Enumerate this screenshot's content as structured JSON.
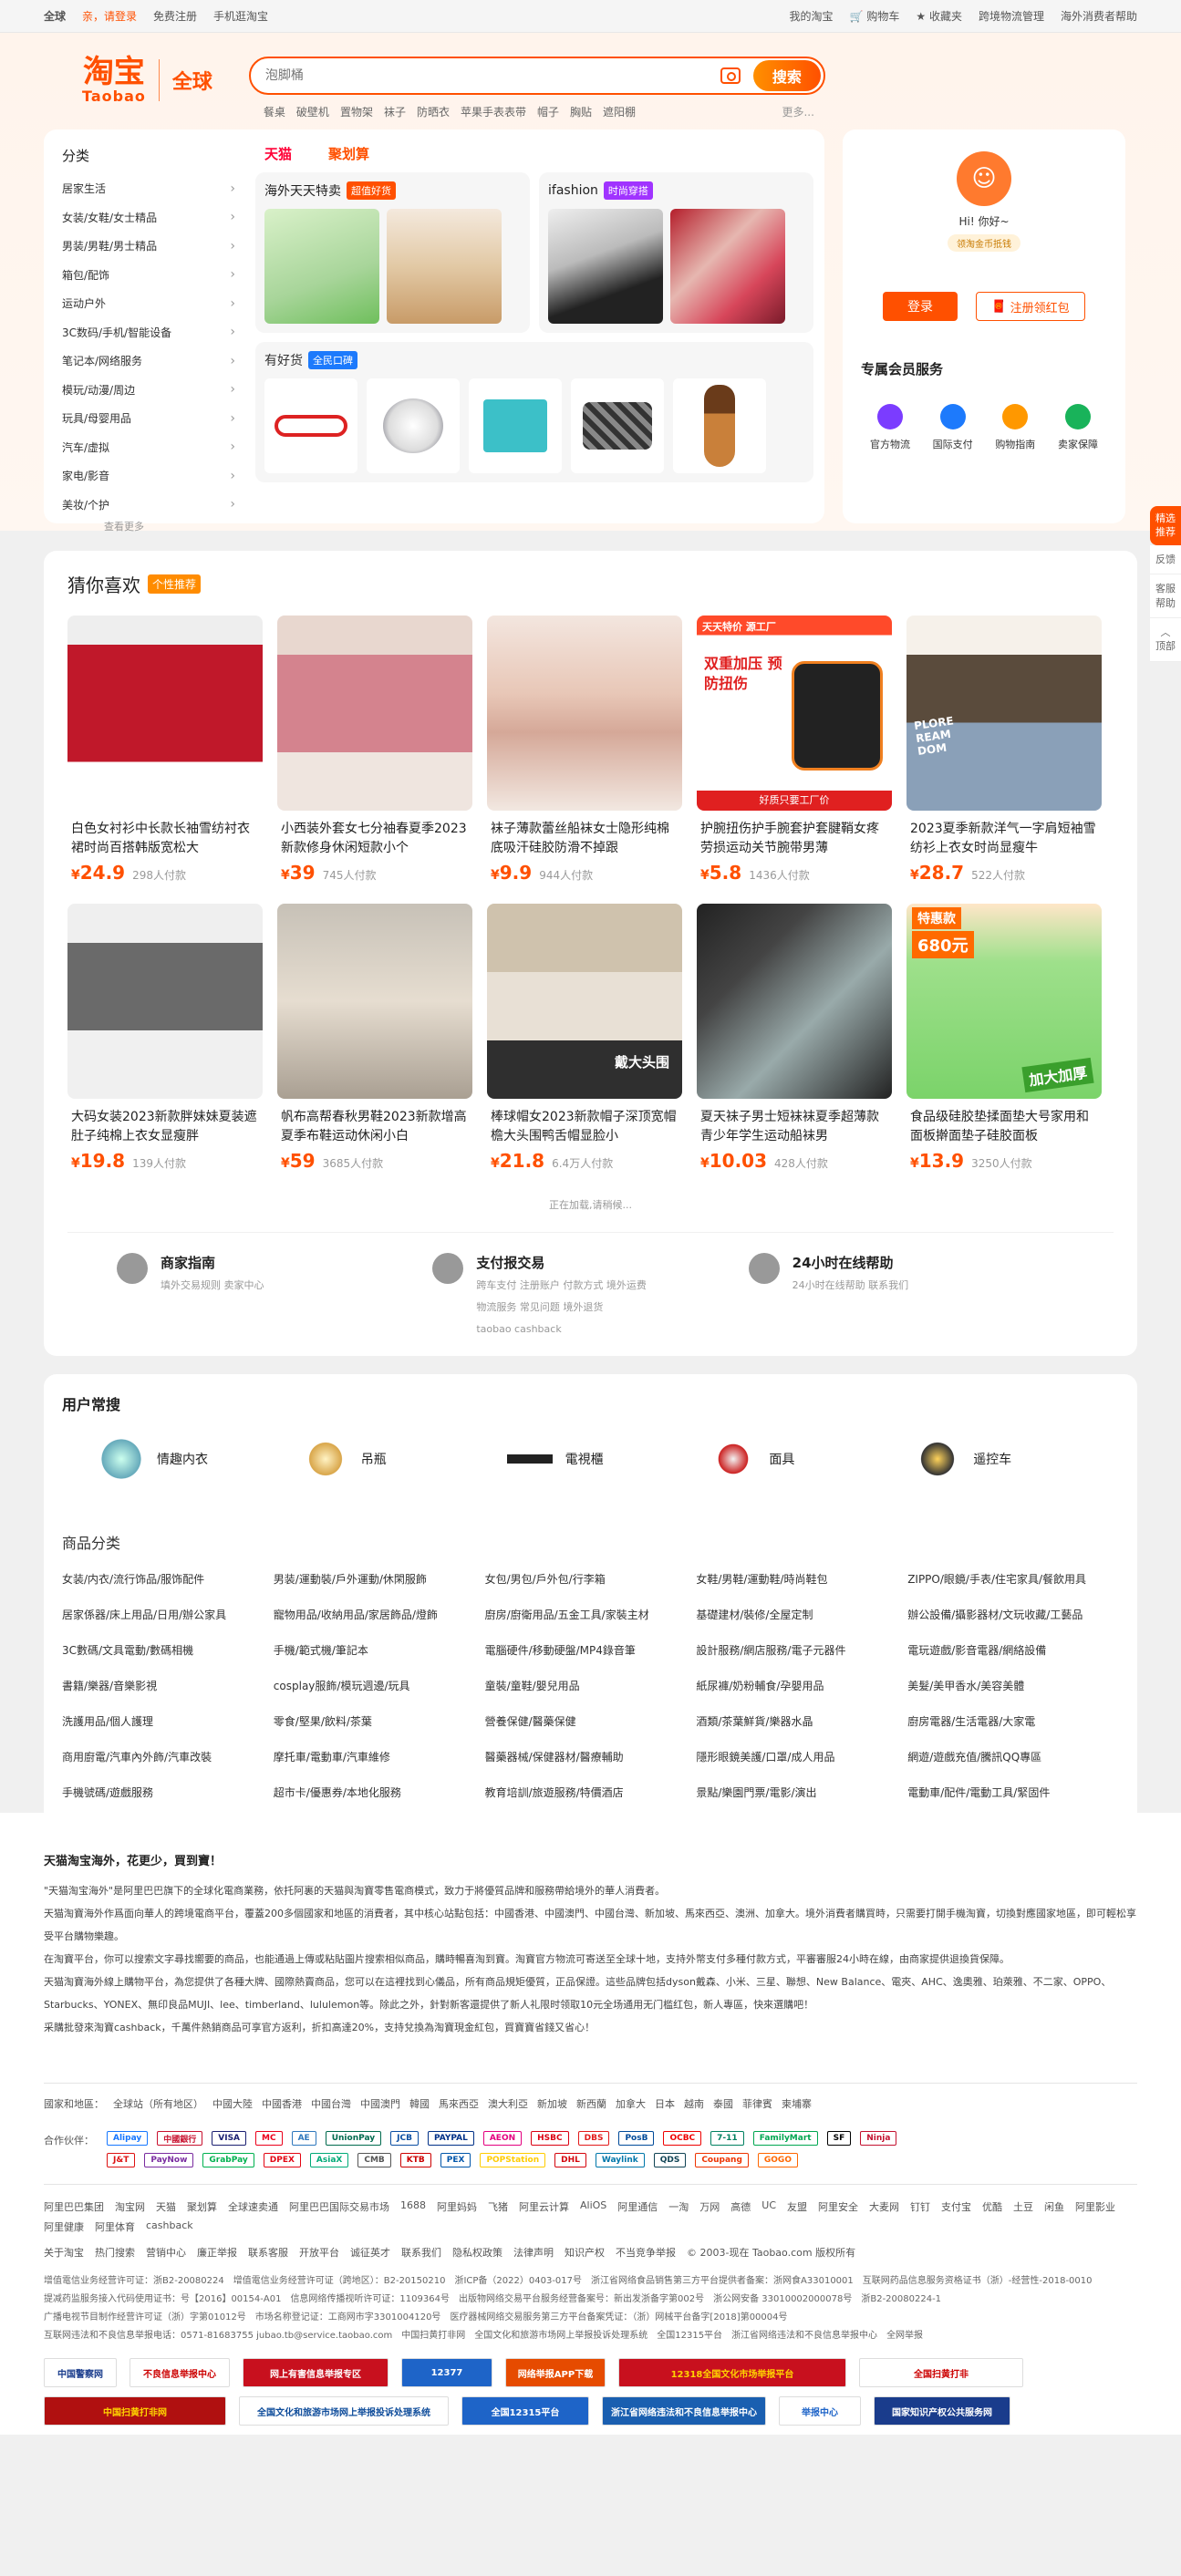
{
  "topbar": {
    "region": "全球",
    "greeting": "亲，请登录",
    "register": "免费注册",
    "mobile": "手机逛淘宝",
    "my_taobao": "我的淘宝",
    "cart": "购物车",
    "favorites": "收藏夹",
    "logistics": "跨境物流管理",
    "help": "海外消费者帮助"
  },
  "logo": {
    "cn": "淘宝",
    "en": "Taobao",
    "global": "全球"
  },
  "search": {
    "placeholder": "泡脚桶",
    "button": "搜索",
    "hotwords": [
      "餐桌",
      "破壁机",
      "置物架",
      "袜子",
      "防晒衣",
      "苹果手表表带",
      "帽子",
      "胸贴",
      "遮阳棚"
    ],
    "more": "更多..."
  },
  "categories": {
    "title": "分类",
    "items": [
      "居家生活",
      "女装/女鞋/女士精品",
      "男装/男鞋/男士精品",
      "箱包/配饰",
      "运动户外",
      "3C数码/手机/智能设备",
      "笔记本/网络服务",
      "模玩/动漫/周边",
      "玩具/母婴用品",
      "汽车/虚拟",
      "家电/影音",
      "美妆/个护"
    ],
    "more": "查看更多"
  },
  "promo": {
    "tab_tmall": "天猫",
    "tab_jhs": "聚划算",
    "haiwai": {
      "title": "海外天天特卖",
      "badge": "超值好货"
    },
    "ifashion": {
      "title": "ifashion",
      "badge": "时尚穿搭"
    },
    "youhaohuo": {
      "title": "有好货",
      "badge": "全民口碑"
    }
  },
  "user": {
    "hi": "Hi! 你好~",
    "level": "领淘金币抵钱",
    "login": "登录",
    "register": "注册领红包",
    "services_title": "专属会员服务",
    "services": [
      "官方物流",
      "国际支付",
      "购物指南",
      "卖家保障"
    ]
  },
  "float": {
    "recommend": "精选推荐",
    "feedback": "反馈",
    "service": "客服帮助",
    "top": "顶部"
  },
  "guess": {
    "title": "猜你喜欢",
    "badge": "个性推荐",
    "items": [
      {
        "title": "白色女衬衫中长款长袖雪纺衬衣裙时尚百搭韩版宽松大",
        "price": "24.9",
        "sold": "298人付款"
      },
      {
        "title": "小西装外套女七分袖春夏季2023新款修身休闲短款小个",
        "price": "39",
        "sold": "745人付款"
      },
      {
        "title": "袜子薄款蕾丝船袜女士隐形纯棉底吸汗硅胶防滑不掉跟",
        "price": "9.9",
        "sold": "944人付款"
      },
      {
        "title": "护腕扭伤护手腕套护套腱鞘女疼劳损运动关节腕带男薄",
        "price": "5.8",
        "sold": "1436人付款"
      },
      {
        "title": "2023夏季新款洋气一字肩短袖雪纺衫上衣女时尚显瘦牛",
        "price": "28.7",
        "sold": "522人付款"
      },
      {
        "title": "大码女装2023新款胖妹妹夏装遮肚子纯棉上衣女显瘦胖",
        "price": "19.8",
        "sold": "139人付款"
      },
      {
        "title": "帆布高帮春秋男鞋2023新款增高夏季布鞋运动休闲小白",
        "price": "59",
        "sold": "3685人付款"
      },
      {
        "title": "棒球帽女2023新款帽子深顶宽帽檐大头围鸭舌帽显脸小",
        "price": "21.8",
        "sold": "6.4万人付款"
      },
      {
        "title": "夏天袜子男士短袜袜夏季超薄款青少年学生运动船袜男",
        "price": "10.03",
        "sold": "428人付款"
      },
      {
        "title": "食品级硅胶垫揉面垫大号家用和面板擀面垫子硅胶面板",
        "price": "13.9",
        "sold": "3250人付款"
      }
    ],
    "img_texts": {
      "wrist_top": "天天特价 源工厂",
      "wrist_main": "双重加压 预防扭伤",
      "wrist_bottom": "好质只要工厂价",
      "skirt_text": "PLORE REAM DOM",
      "cap_text": "戴大头围",
      "mat_top": "特惠款",
      "mat_price": "680元",
      "mat_bottom": "加大加厚"
    },
    "loading": "正在加载,请稍候..."
  },
  "guide": [
    {
      "title": "商家指南",
      "lines": [
        "填外交易规则 卖家中心"
      ]
    },
    {
      "title": "支付报交易",
      "lines": [
        "跨车支付 注册账户 付款方式 境外运费",
        "物流服务 常见问题 境外退货",
        "taobao cashback"
      ]
    },
    {
      "title": "24小时在线帮助",
      "lines": [
        "24小时在线帮助 联系我们"
      ]
    }
  ],
  "common": {
    "title": "用户常搜",
    "freq": [
      "情趣内衣",
      "吊瓶",
      "電視櫃",
      "面具",
      "遥控车"
    ],
    "cat_title": "商品分类",
    "cats": [
      "女装/内衣/流行饰品/服饰配件",
      "男装/運動裝/戶外運動/休閑服飾",
      "女包/男包/戶外包/行李箱",
      "女鞋/男鞋/運動鞋/時尚鞋包",
      "ZIPPO/眼鏡/手表/住宅家具/餐飲用具",
      "居家係器/床上用品/日用/辦公家具",
      "寵物用品/收納用品/家居飾品/燈飾",
      "廚房/廚衛用品/五金工具/家裝主材",
      "基礎建材/裝修/全屋定制",
      "辦公設備/攝影器材/文玩收藏/工藝品",
      "3C數碼/文具電動/數碼相機",
      "手機/範式機/筆記本",
      "電腦硬件/移動硬盤/MP4錄音筆",
      "設計服務/網店服務/電子元器件",
      "電玩遊戲/影音電器/網絡設備",
      "書籍/樂器/音樂影視",
      "cosplay服飾/模玩週邊/玩具",
      "童裝/童鞋/嬰兒用品",
      "紙尿褲/奶粉輔食/孕嬰用品",
      "美髮/美甲香水/美容美體",
      "洗護用品/個人護理",
      "零食/堅果/飲料/茶葉",
      "營養保健/醫藥保健",
      "酒類/茶葉鮮貨/樂器水晶",
      "廚房電器/生活電器/大家電",
      "商用廚電/汽車內外飾/汽車改裝",
      "摩托車/電動車/汽車維修",
      "醫藥器械/保健器材/醫療輔助",
      "隱形眼鏡美護/口罩/成人用品",
      "網遊/遊戲充值/騰訊QQ專區",
      "手機號碼/遊戲服務",
      "超市卡/優惠券/本地化服務",
      "教育培訓/旅遊服務/特價酒店",
      "景點/樂園門票/電影/演出",
      "電動車/配件/電動工具/緊固件"
    ]
  },
  "about": {
    "heading": "天猫淘宝海外，花更少，買到寶！",
    "p1": "\"天猫淘宝海外\"是阿里巴巴旗下的全球化電商業務，依托阿裏的天猫與淘寶零售電商模式，致力于將優質品牌和服務帶給境外的華人消費者。",
    "p2": "天猫淘寶海外作爲面向華人的跨境電商平台，覆蓋200多個國家和地區的消費者，其中核心站點包括：中國香港、中國澳門、中國台灣、新加坡、馬來西亞、澳洲、加拿大。境外消費者購買時，只需要打開手機淘寶，切換對應國家地區，即可輕松享受平台購物樂趣。",
    "p3": "在淘寶平台，你可以搜索文字尋找嚮要的商品，也能通過上傳或粘貼圖片搜索相似商品，購時暢喜淘到寶。淘寶官方物流可寄送至全球十地，支持外幣支付多種付款方式，平審審服24小時在線，由商家提供退換貨保障。",
    "p4": "天猫淘寶海外線上購物平台，為您提供了各種大牌、國際熱賣商品，您可以在這裡找到心儀品，所有商品規矩優質，正品保證。這些品牌包括dyson戴森、小米、三星、聯想、New Balance、電夾、AHC、逸奧雅、珀萊雅、不二家、OPPO、Starbucks、YONEX、無印良品MUJI、lee、timberland、lululemon等。除此之外，針對新客還提供了新人礼限时领取10元全场通用无门槛红包，新人專區，快來選購吧！",
    "p5": "采購批發來淘寶cashback，千萬件熱銷商品可享官方返利，折扣高達20%，支持兌換為淘寶現金紅包，買寶寶省錢又省心！"
  },
  "footer": {
    "region_label": "國家和地區：",
    "regions": [
      "全球站（所有地区）",
      "中國大陸",
      "中國香港",
      "中國台灣",
      "中國澳門",
      "韓國",
      "馬來西亞",
      "澳大利亞",
      "新加坡",
      "新西蘭",
      "加拿大",
      "日本",
      "越南",
      "泰國",
      "菲律賓",
      "柬埔寨"
    ],
    "partner_label": "合作伙伴：",
    "partner_logos": [
      "Alipay",
      "中國銀行",
      "VISA",
      "MC",
      "AE",
      "UnionPay",
      "JCB",
      "PAYPAL",
      "AEON",
      "HSBC",
      "DBS",
      "PosB",
      "OCBC",
      "7-11",
      "FamilyMart",
      "SF",
      "Ninja",
      "J&T",
      "PayNow",
      "GrabPay",
      "DPEX",
      "AsiaX",
      "CMB",
      "KTB",
      "PEX",
      "POPStation",
      "DHL",
      "Waylink",
      "QDS",
      "Coupang",
      "GOGO"
    ],
    "group_links": [
      "阿里巴巴集团",
      "淘宝网",
      "天猫",
      "聚划算",
      "全球速卖通",
      "阿里巴巴国际交易市场",
      "1688",
      "阿里妈妈",
      "飞猪",
      "阿里云计算",
      "AliOS",
      "阿里通信",
      "一淘",
      "万网",
      "高德",
      "UC",
      "友盟",
      "阿里安全",
      "大麦网",
      "钉钉",
      "支付宝",
      "优酷",
      "土豆",
      "闲鱼",
      "阿里影业",
      "阿里健康",
      "阿里体育",
      "cashback"
    ],
    "about_links": [
      "关于淘宝",
      "热门搜索",
      "营销中心",
      "廉正举报",
      "联系客服",
      "开放平台",
      "诚征英才",
      "联系我们",
      "隐私权政策",
      "法律声明",
      "知识产权",
      "不当竞争举报",
      "© 2003-现在 Taobao.com 版权所有"
    ],
    "license": [
      "增值電信业务经营许可证：浙B2-20080224",
      "增值電信业务经营许可证（跨地区）：B2-20150210",
      "浙ICP备（2022）0403-017号",
      "浙江省网络食品销售第三方平台提供者备案：浙网食A33010001",
      "互联网药品信息服务资格证书（浙）-经营性-2018-0010",
      "提减药监服务接入代码使用证书：号【2016】00154-A01",
      "信息网络传播视听许可证：1109364号",
      "出版物网络交易平台服务经营备案号：新出发浙备字第002号",
      "浙公网安备 33010002000078号",
      "浙B2-20080224-1",
      "广播电视节目制作经营许可证（浙）字第01012号",
      "市场名称登记证：工商网市字3301004120号",
      "医疗器械网络交易服务第三方平台备案凭证：（浙）网械平台备字[2018]第00004号",
      "互联网违法和不良信息举报电话：0571-81683755 jubao.tb@service.taobao.com",
      "中国扫黄打非网",
      "全国文化和旅游市场网上举报投诉处理系统",
      "全国12315平台",
      "浙江省网络违法和不良信息举报中心",
      "全网举报"
    ],
    "badges": [
      "中国警察网",
      "不良信息举报中心",
      "网上有害信息举报专区",
      "12377",
      "网络举报APP下载",
      "12318全国文化市场举报平台",
      "全国扫黄打非",
      "中国扫黄打非网",
      "全国文化和旅游市场网上举报投诉处理系统",
      "全国12315平台",
      "浙江省网络违法和不良信息举报中心",
      "举报中心",
      "国家知识产权公共服务网"
    ]
  }
}
